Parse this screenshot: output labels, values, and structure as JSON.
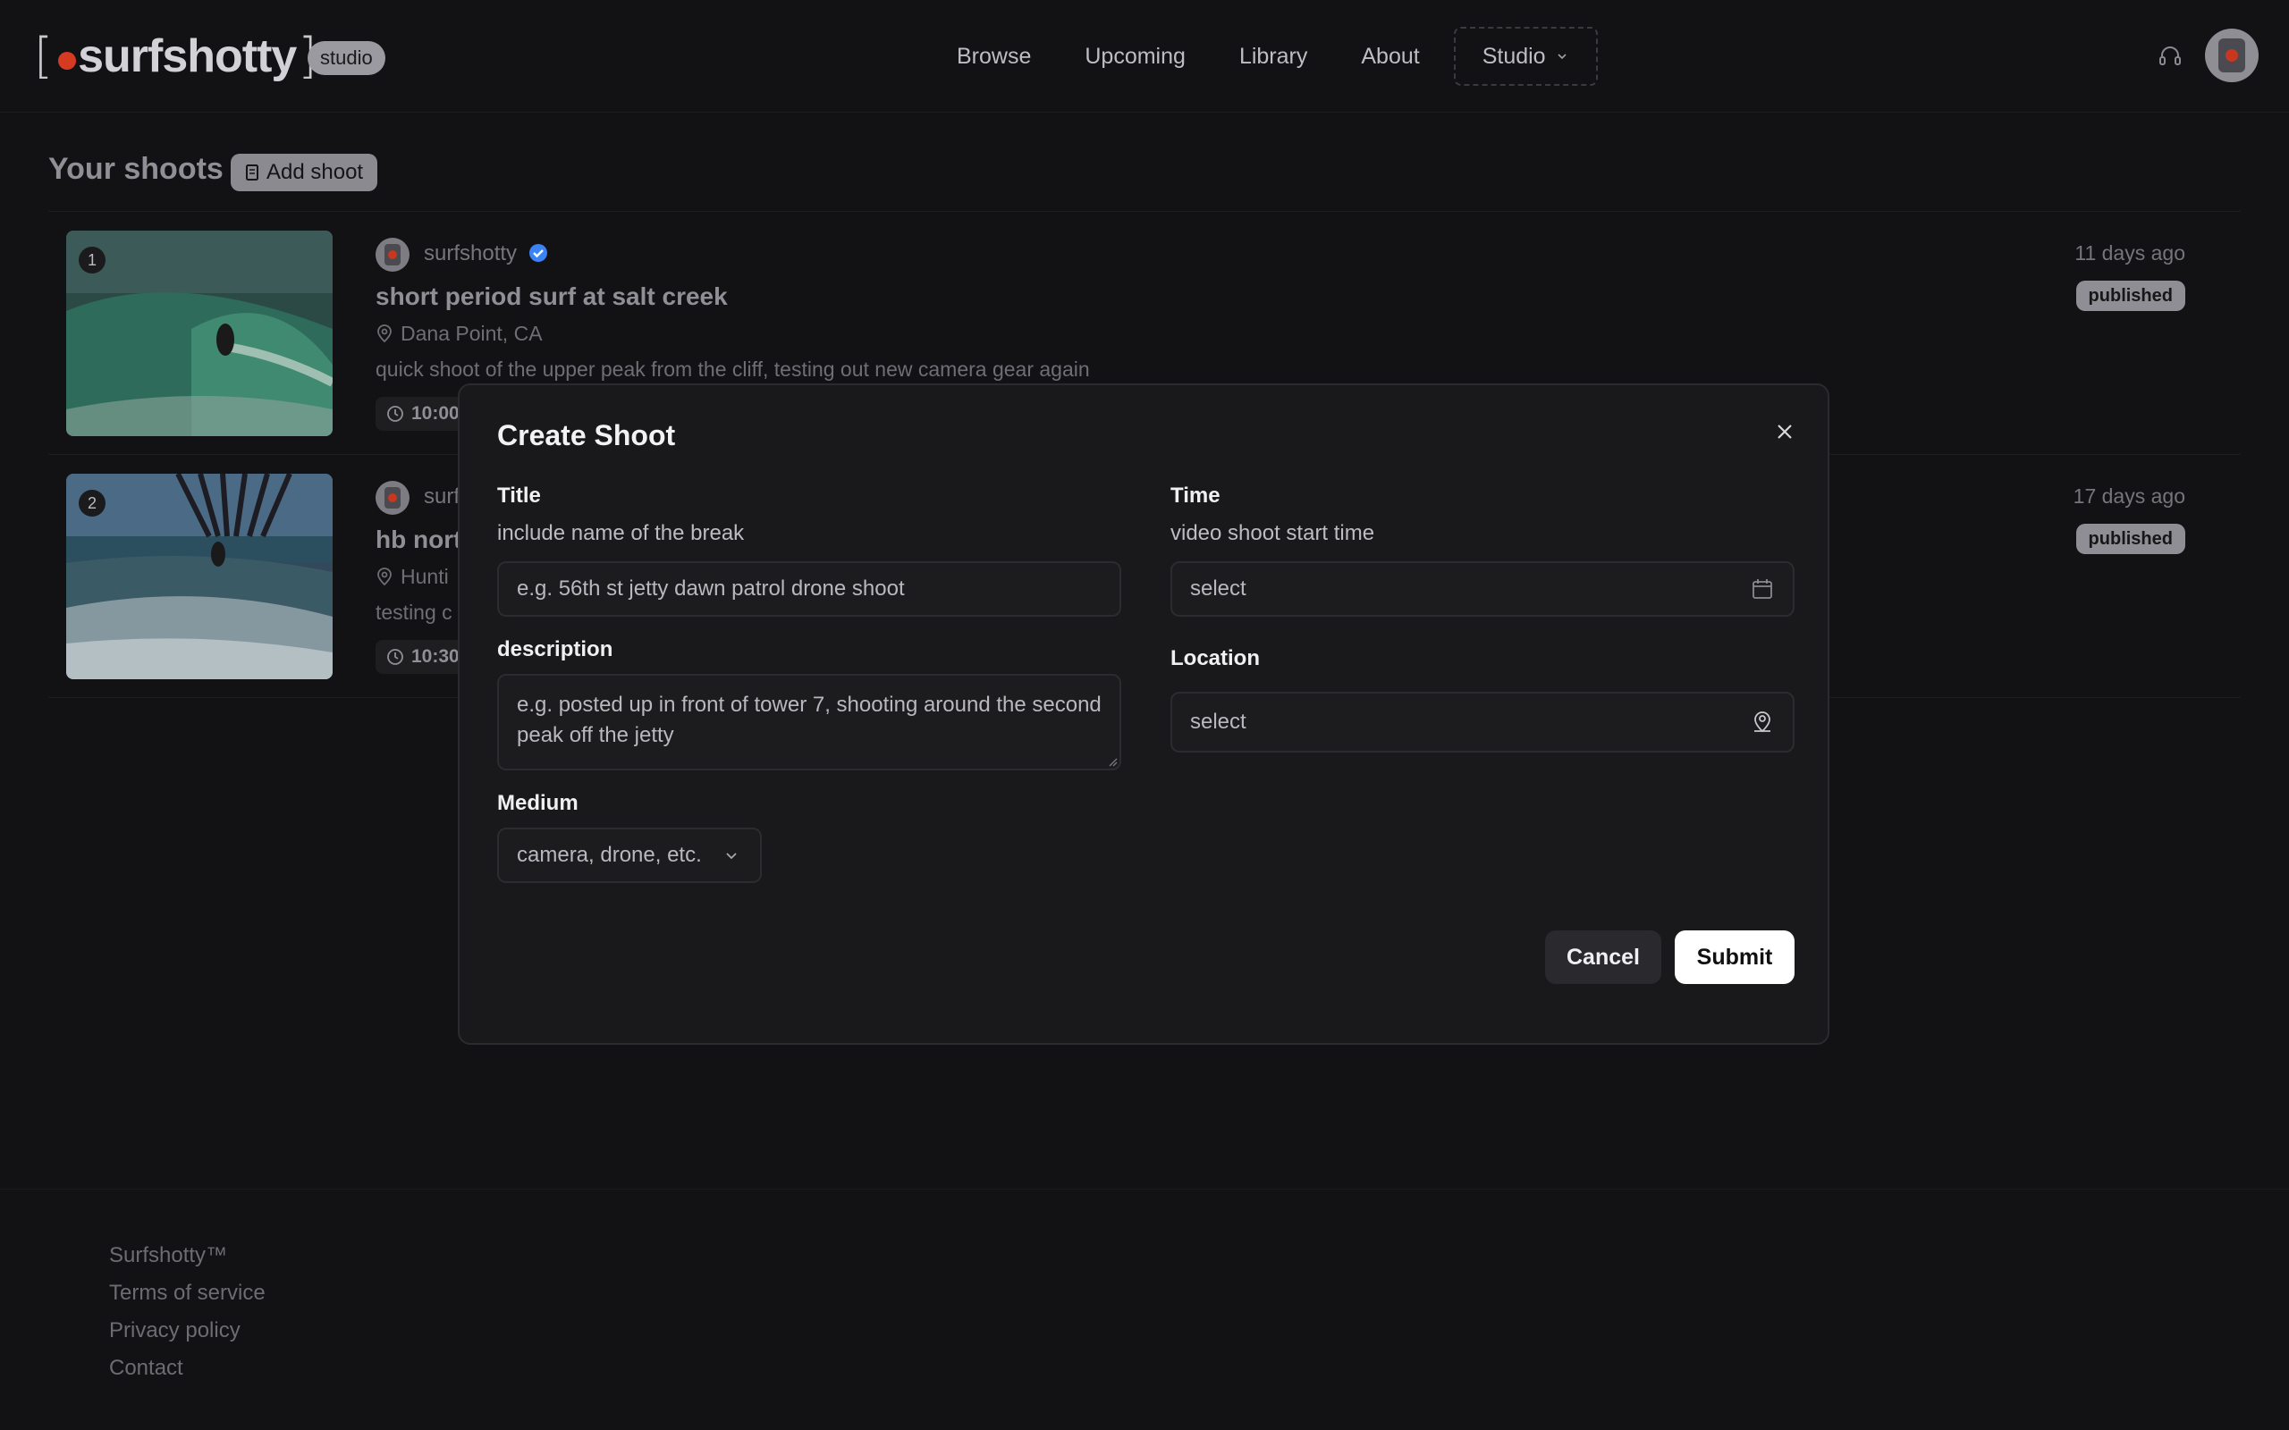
{
  "header": {
    "brand": "surfshotty",
    "badge": "studio",
    "nav": [
      "Browse",
      "Upcoming",
      "Library",
      "About",
      "Studio"
    ]
  },
  "main": {
    "title": "Your shoots",
    "add_button": "Add shoot",
    "shoots": [
      {
        "index": "1",
        "author": "surfshotty",
        "title": "short period surf at salt creek",
        "location": "Dana Point, CA",
        "description": "quick shoot of the upper peak from the cliff, testing out new camera gear again",
        "time": "10:00",
        "ago": "11 days ago",
        "status": "published"
      },
      {
        "index": "2",
        "author": "surf",
        "title": "hb nort",
        "location": "Hunti",
        "description": "testing c",
        "time": "10:30",
        "ago": "17 days ago",
        "status": "published"
      }
    ]
  },
  "modal": {
    "title": "Create Shoot",
    "title_field": {
      "label": "Title",
      "help": "include name of the break",
      "placeholder": "e.g. 56th st jetty dawn patrol drone shoot"
    },
    "description_field": {
      "label": "description",
      "placeholder": "e.g. posted up in front of tower 7, shooting around the second peak off the jetty"
    },
    "medium_field": {
      "label": "Medium",
      "value": "camera, drone, etc."
    },
    "time_field": {
      "label": "Time",
      "help": "video shoot start time",
      "value": "select"
    },
    "location_field": {
      "label": "Location",
      "value": "select"
    },
    "cancel": "Cancel",
    "submit": "Submit"
  },
  "footer": {
    "links": [
      "Surfshotty™",
      "Terms of service",
      "Privacy policy",
      "Contact"
    ]
  },
  "colors": {
    "background": "#121214",
    "modal": "#19191b",
    "accent_red": "#d63a22",
    "verified_blue": "#3b82f6"
  }
}
